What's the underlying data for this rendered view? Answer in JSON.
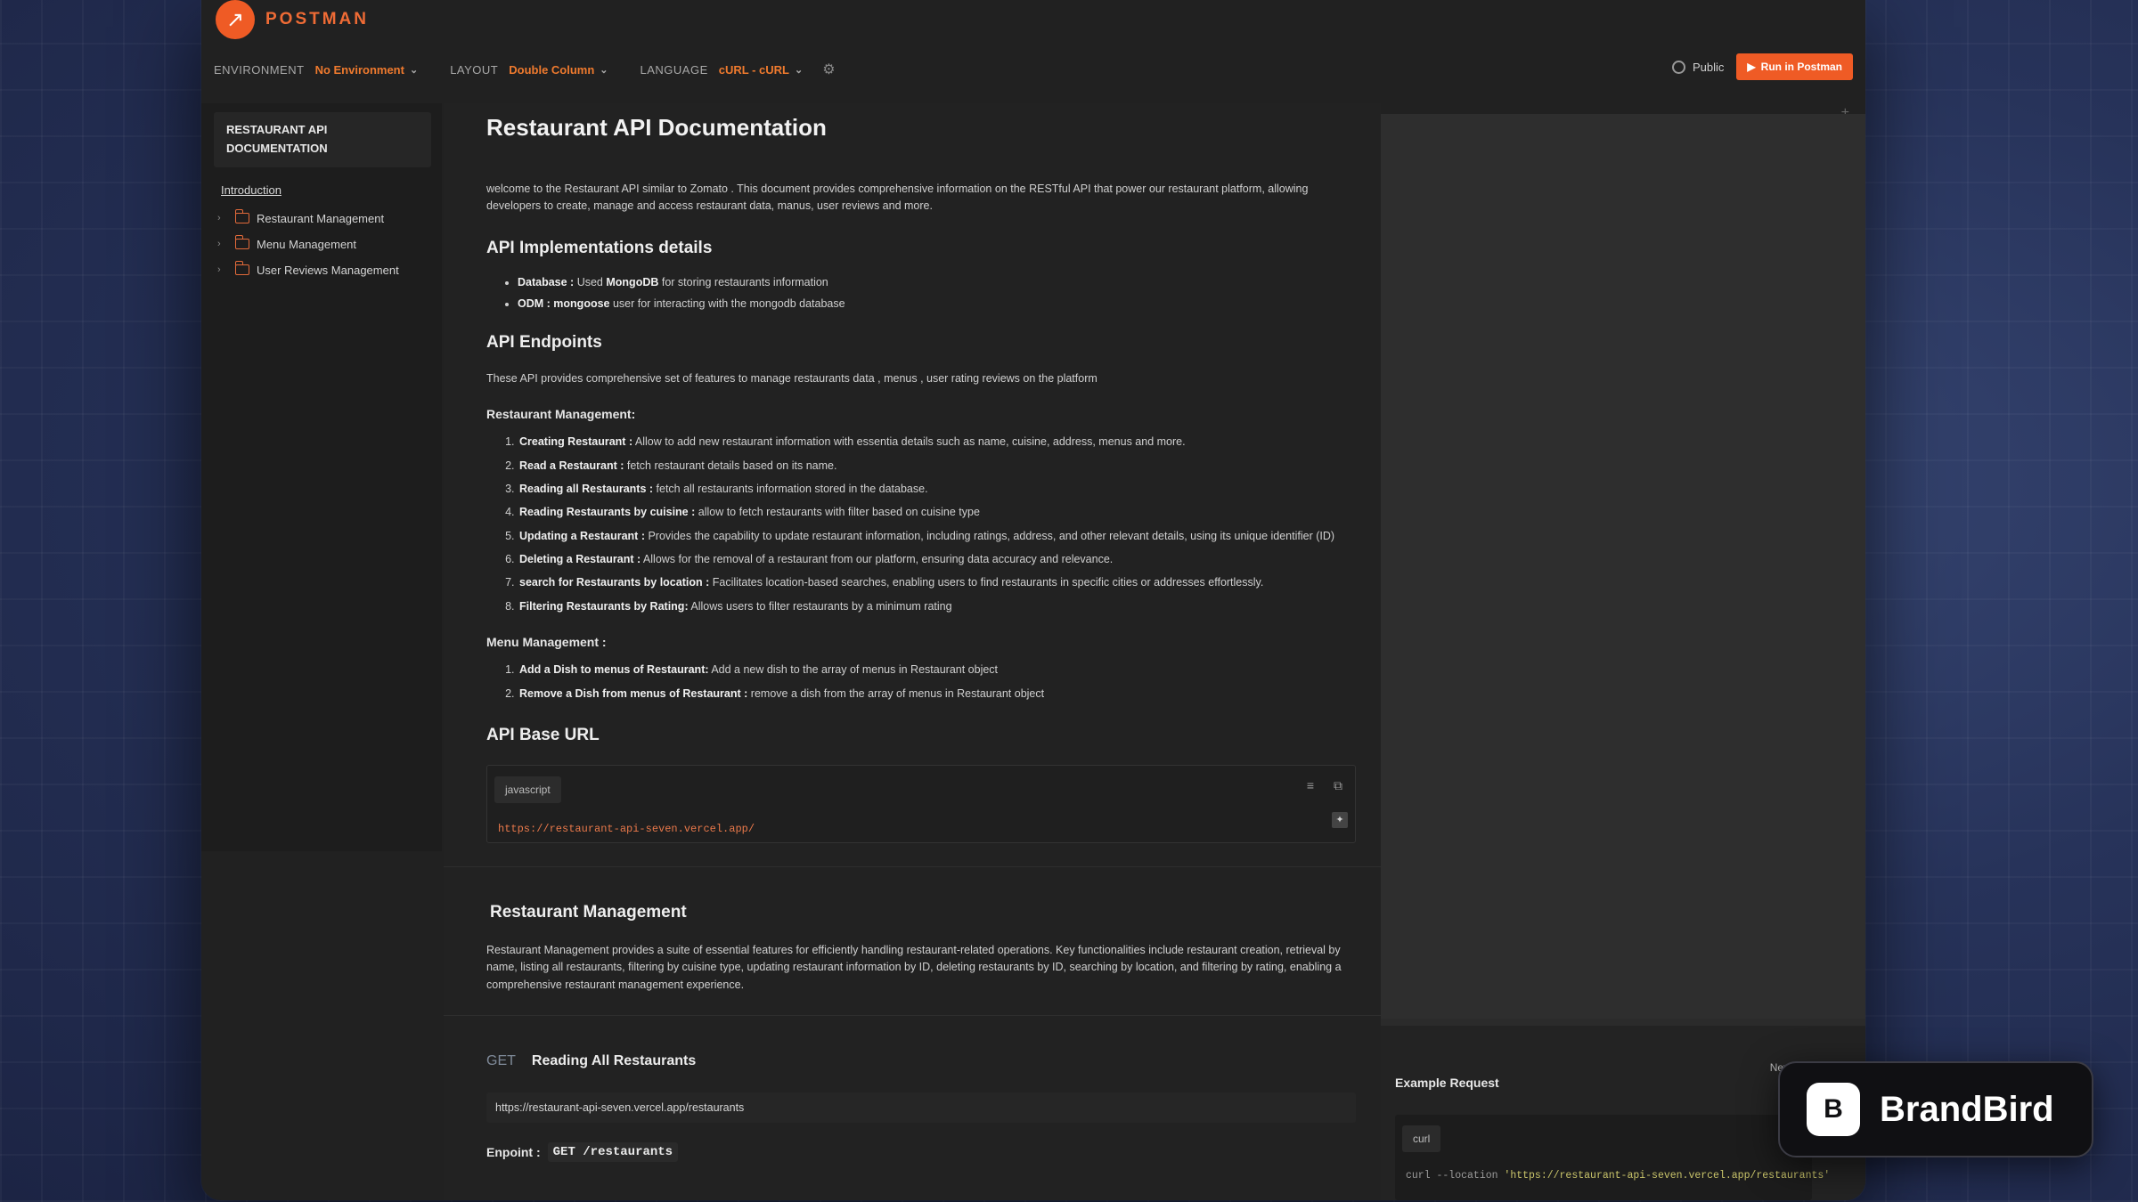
{
  "app": {
    "brand": "POSTMAN"
  },
  "toolbar": {
    "environment_label": "ENVIRONMENT",
    "environment_value": "No Environment",
    "layout_label": "LAYOUT",
    "layout_value": "Double Column",
    "language_label": "LANGUAGE",
    "language_value": "cURL - cURL"
  },
  "header_right": {
    "public_label": "Public",
    "run_button": "Run in Postman"
  },
  "sidebar": {
    "title": "RESTAURANT API DOCUMENTATION",
    "intro": "Introduction",
    "items": [
      {
        "label": "Restaurant Management"
      },
      {
        "label": "Menu Management"
      },
      {
        "label": "User Reviews Management"
      }
    ]
  },
  "doc": {
    "title": "Restaurant API Documentation",
    "intro": "welcome to the Restaurant API similar to Zomato . This document provides comprehensive information on the RESTful API that power our restaurant platform, allowing developers to create, manage and access restaurant data, manus, user reviews and more.",
    "impl_heading": "API Implementations details",
    "impl_items": [
      {
        "key": "Database :",
        "pre": " Used ",
        "bold": "MongoDB",
        "post": " for storing restaurants information"
      },
      {
        "key": "ODM :",
        "pre": " ",
        "bold": "mongoose",
        "post": " user for interacting with the mongodb database"
      }
    ],
    "endpoints_heading": "API Endpoints",
    "endpoints_intro": "These API provides comprehensive set of features to manage restaurants data , menus , user rating reviews on the platform",
    "rm_heading": "Restaurant Management:",
    "rm_items": [
      {
        "key": "Creating Restaurant :",
        "text": " Allow to add new restaurant information with essentia details such as name, cuisine, address, menus and more."
      },
      {
        "key": "Read a Restaurant :",
        "text": " fetch restaurant details based on its name."
      },
      {
        "key": "Reading all Restaurants :",
        "text": " fetch all restaurants information stored in the database."
      },
      {
        "key": "Reading Restaurants by cuisine :",
        "text": " allow to fetch restaurants with filter based on cuisine type"
      },
      {
        "key": "Updating a Restaurant :",
        "text": " Provides the capability to update restaurant information, including ratings, address, and other relevant details, using its unique identifier (ID)"
      },
      {
        "key": "Deleting a Restaurant :",
        "text": " Allows for the removal of a restaurant from our platform, ensuring data accuracy and relevance."
      },
      {
        "key": "search for Restaurants by location :",
        "text": " Facilitates location-based searches, enabling users to find restaurants in specific cities or addresses effortlessly."
      },
      {
        "key": "Filtering Restaurants by Rating:",
        "text": " Allows users to filter restaurants by a minimum rating"
      }
    ],
    "mm_heading": "Menu Management :",
    "mm_items": [
      {
        "key": "Add a Dish to menus of Restaurant:",
        "text": " Add a new dish to the array of menus in Restaurant object"
      },
      {
        "key": "Remove a Dish from menus of Restaurant :",
        "text": " remove a dish from the array of menus in Restaurant object"
      }
    ],
    "base_url_heading": "API Base URL",
    "code_lang": "javascript",
    "base_url": "https://restaurant-api-seven.vercel.app/",
    "section_title": "Restaurant Management",
    "section_desc": "Restaurant Management provides a suite of essential features for efficiently handling restaurant-related operations. Key functionalities include restaurant creation, retrieval by name, listing all restaurants, filtering by cuisine type, updating restaurant information by ID, deleting restaurants by ID, searching by location, and filtering by rating, enabling a comprehensive restaurant management experience.",
    "request": {
      "method": "GET",
      "name": "Reading All Restaurants",
      "url": "https://restaurant-api-seven.vercel.app/restaurants",
      "endpoint_label": "Enpoint :",
      "endpoint_value": "GET /restaurants"
    }
  },
  "example": {
    "title": "Example Request",
    "select_value": "New Request",
    "tab": "curl",
    "code_prefix": "curl --location ",
    "code_string": "'https://restaurant-api-seven.vercel.app/restaurants'"
  },
  "badge": {
    "text": "BrandBird"
  }
}
